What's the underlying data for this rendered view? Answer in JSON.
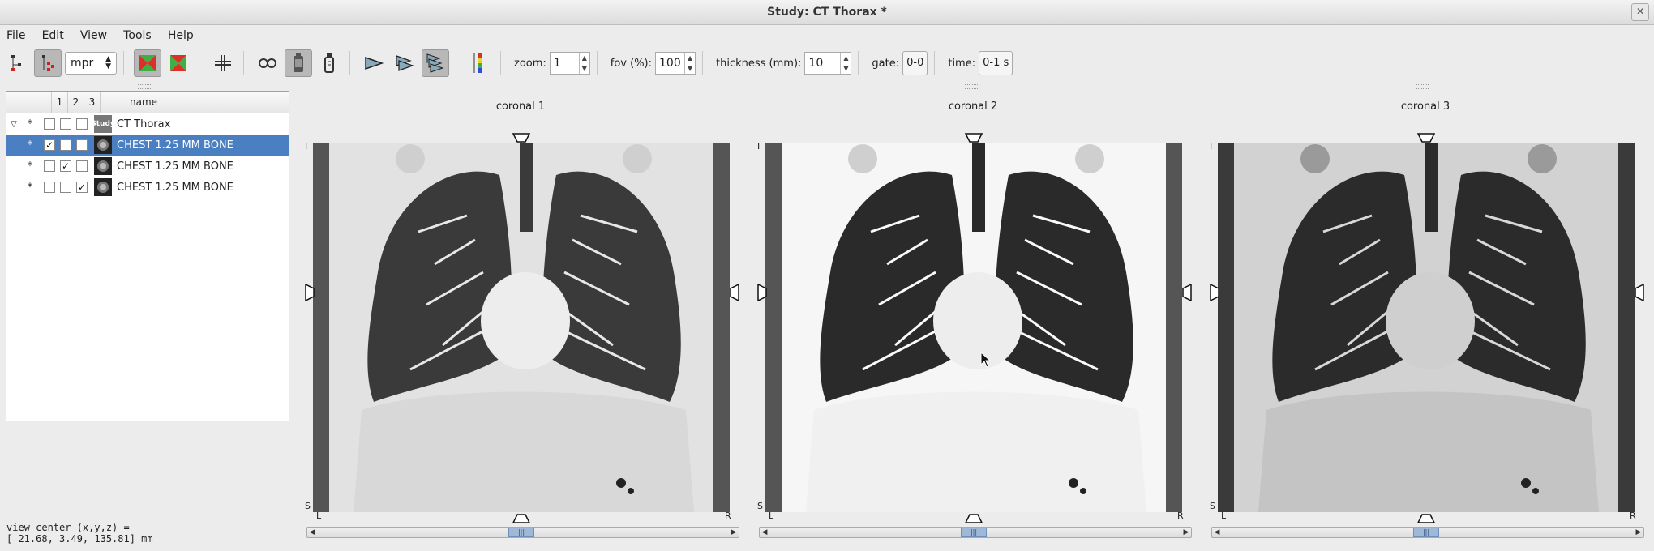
{
  "window": {
    "title": "Study: CT Thorax *",
    "close_glyph": "✕"
  },
  "menu": [
    "File",
    "Edit",
    "View",
    "Tools",
    "Help"
  ],
  "toolbar": {
    "mode_value": "mpr",
    "zoom_label": "zoom:",
    "zoom_value": "1",
    "fov_label": "fov (%):",
    "fov_value": "100",
    "thickness_label": "thickness (mm):",
    "thickness_value": "10",
    "gate_label": "gate:",
    "gate_value": "0-0",
    "time_label": "time:",
    "time_value": "0-1 s"
  },
  "tree": {
    "columns": [
      "1",
      "2",
      "3",
      "name"
    ],
    "rows": [
      {
        "expander": "▽",
        "star": "*",
        "checks": [
          false,
          false,
          false
        ],
        "thumb": "Study",
        "name": "CT Thorax",
        "selected": false
      },
      {
        "expander": "",
        "star": "*",
        "checks": [
          true,
          false,
          false
        ],
        "thumb": "",
        "name": "CHEST 1.25 MM BONE",
        "selected": true
      },
      {
        "expander": "",
        "star": "*",
        "checks": [
          false,
          true,
          false
        ],
        "thumb": "",
        "name": "CHEST 1.25 MM BONE",
        "selected": false
      },
      {
        "expander": "",
        "star": "*",
        "checks": [
          false,
          false,
          true
        ],
        "thumb": "",
        "name": "CHEST 1.25 MM BONE",
        "selected": false
      }
    ]
  },
  "status": {
    "line1": "view center (x,y,z) =",
    "line2": "[ 21.68, 3.49, 135.81] mm"
  },
  "viewports": [
    {
      "title": "coronal 1",
      "top": "I",
      "bottom": "S",
      "left": "L",
      "right": "R",
      "style": "soft"
    },
    {
      "title": "coronal 2",
      "top": "I",
      "bottom": "S",
      "left": "L",
      "right": "R",
      "style": "mip"
    },
    {
      "title": "coronal 3",
      "top": "I",
      "bottom": "S",
      "left": "L",
      "right": "R",
      "style": "dense"
    }
  ],
  "colors": {
    "selection": "#4a7fc1",
    "accent_green": "#3cb043",
    "accent_red": "#d9302c"
  }
}
